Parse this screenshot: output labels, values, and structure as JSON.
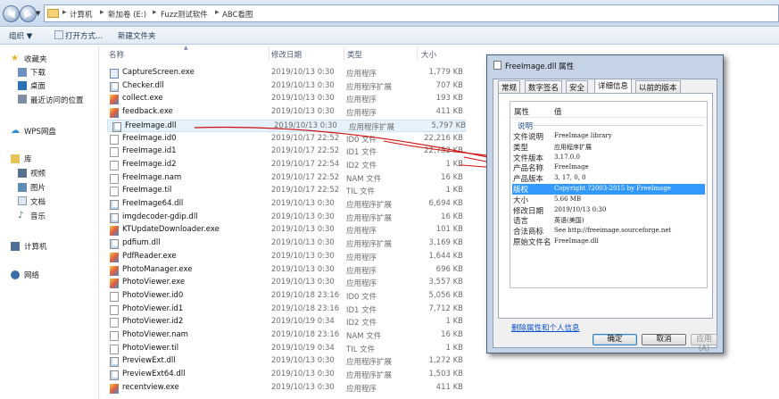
{
  "explorer": {
    "breadcrumbs": [
      "计算机",
      "新加卷 (E:)",
      "Fuzz测试软件",
      "ABC看图"
    ],
    "toolbar": {
      "organize": "组织 ▼",
      "open_with": "打开方式...",
      "new_folder": "新建文件夹"
    },
    "sidebar": {
      "favorites": "收藏夹",
      "downloads": "下载",
      "desktop": "桌面",
      "recent": "最近访问的位置",
      "wps_cloud": "WPS网盘",
      "libraries": "库",
      "videos": "视频",
      "pictures": "图片",
      "documents": "文档",
      "music": "音乐",
      "computer": "计算机",
      "network": "网络"
    },
    "columns": {
      "name": "名称",
      "date": "修改日期",
      "type": "类型",
      "size": "大小"
    },
    "files": [
      {
        "name": "CaptureScreen.exe",
        "date": "2019/10/13 0:30",
        "type": "应用程序",
        "size": "1,779 KB",
        "icon": "exe-icon"
      },
      {
        "name": "Checker.dll",
        "date": "2019/10/13 0:30",
        "type": "应用程序扩展",
        "size": "707 KB",
        "icon": "dll-icon"
      },
      {
        "name": "collect.exe",
        "date": "2019/10/13 0:30",
        "type": "应用程序",
        "size": "193 KB",
        "icon": "app-icon"
      },
      {
        "name": "feedback.exe",
        "date": "2019/10/13 0:30",
        "type": "应用程序",
        "size": "411 KB",
        "icon": "app-icon"
      },
      {
        "name": "FreeImage.dll",
        "date": "2019/10/13 0:30",
        "type": "应用程序扩展",
        "size": "5,797 KB",
        "icon": "dll-icon"
      },
      {
        "name": "FreeImage.id0",
        "date": "2019/10/17 22:52",
        "type": "ID0 文件",
        "size": "22,216 KB",
        "icon": "file-icon"
      },
      {
        "name": "FreeImage.id1",
        "date": "2019/10/17 22:52",
        "type": "ID1 文件",
        "size": "22,752 KB",
        "icon": "file-icon"
      },
      {
        "name": "FreeImage.id2",
        "date": "2019/10/17 22:54",
        "type": "ID2 文件",
        "size": "1 KB",
        "icon": "file-icon"
      },
      {
        "name": "FreeImage.nam",
        "date": "2019/10/17 22:52",
        "type": "NAM 文件",
        "size": "16 KB",
        "icon": "file-icon"
      },
      {
        "name": "FreeImage.til",
        "date": "2019/10/17 22:52",
        "type": "TIL 文件",
        "size": "1 KB",
        "icon": "file-icon"
      },
      {
        "name": "FreeImage64.dll",
        "date": "2019/10/13 0:30",
        "type": "应用程序扩展",
        "size": "6,694 KB",
        "icon": "dll-icon"
      },
      {
        "name": "imgdecoder-gdip.dll",
        "date": "2019/10/13 0:30",
        "type": "应用程序扩展",
        "size": "16 KB",
        "icon": "dll-icon"
      },
      {
        "name": "KTUpdateDownloader.exe",
        "date": "2019/10/13 0:30",
        "type": "应用程序",
        "size": "101 KB",
        "icon": "app-icon"
      },
      {
        "name": "pdfium.dll",
        "date": "2019/10/13 0:30",
        "type": "应用程序扩展",
        "size": "3,169 KB",
        "icon": "dll-icon"
      },
      {
        "name": "PdfReader.exe",
        "date": "2019/10/13 0:30",
        "type": "应用程序",
        "size": "1,644 KB",
        "icon": "app-icon"
      },
      {
        "name": "PhotoManager.exe",
        "date": "2019/10/13 0:30",
        "type": "应用程序",
        "size": "696 KB",
        "icon": "app-icon"
      },
      {
        "name": "PhotoViewer.exe",
        "date": "2019/10/13 0:30",
        "type": "应用程序",
        "size": "3,557 KB",
        "icon": "app-icon"
      },
      {
        "name": "PhotoViewer.id0",
        "date": "2019/10/18 23:16",
        "type": "ID0 文件",
        "size": "5,056 KB",
        "icon": "file-icon"
      },
      {
        "name": "PhotoViewer.id1",
        "date": "2019/10/18 23:16",
        "type": "ID1 文件",
        "size": "7,712 KB",
        "icon": "file-icon"
      },
      {
        "name": "PhotoViewer.id2",
        "date": "2019/10/19 0:34",
        "type": "ID2 文件",
        "size": "1 KB",
        "icon": "file-icon"
      },
      {
        "name": "PhotoViewer.nam",
        "date": "2019/10/18 23:16",
        "type": "NAM 文件",
        "size": "16 KB",
        "icon": "file-icon"
      },
      {
        "name": "PhotoViewer.til",
        "date": "2019/10/19 0:34",
        "type": "TIL 文件",
        "size": "1 KB",
        "icon": "file-icon"
      },
      {
        "name": "PreviewExt.dll",
        "date": "2019/10/13 0:30",
        "type": "应用程序扩展",
        "size": "1,272 KB",
        "icon": "dll-icon"
      },
      {
        "name": "PreviewExt64.dll",
        "date": "2019/10/13 0:30",
        "type": "应用程序扩展",
        "size": "1,503 KB",
        "icon": "dll-icon"
      },
      {
        "name": "recentview.exe",
        "date": "2019/10/13 0:30",
        "type": "应用程序",
        "size": "411 KB",
        "icon": "app-icon"
      }
    ]
  },
  "dialog": {
    "title": "FreeImage.dll 属性",
    "tabs": [
      "常规",
      "数字签名",
      "安全",
      "详细信息",
      "以前的版本"
    ],
    "active_tab": "详细信息",
    "header_property": "属性",
    "header_value": "值",
    "group": "说明",
    "properties": [
      {
        "key": "文件说明",
        "value": "FreeImage library"
      },
      {
        "key": "类型",
        "value": "应用程序扩展"
      },
      {
        "key": "文件版本",
        "value": "3.17.0.0"
      },
      {
        "key": "产品名称",
        "value": "FreeImage"
      },
      {
        "key": "产品版本",
        "value": "3, 17, 0, 0"
      },
      {
        "key": "版权",
        "value": "Copyright ?2003-2015 by FreeImage"
      },
      {
        "key": "大小",
        "value": "5.66 MB"
      },
      {
        "key": "修改日期",
        "value": "2019/10/13 0:30"
      },
      {
        "key": "语言",
        "value": "英语(美国)"
      },
      {
        "key": "合法商标",
        "value": "See http://freeimage.sourceforge.net"
      },
      {
        "key": "原始文件名",
        "value": "FreeImage.dll"
      }
    ],
    "selected_property": "版权",
    "remove_link": "删除属性和个人信息",
    "buttons": {
      "ok": "确定",
      "cancel": "取消",
      "apply": "应用(A)"
    }
  },
  "colors": {
    "annotation": "#d01010",
    "selection": "#3399ff",
    "link": "#0b4fd1"
  }
}
